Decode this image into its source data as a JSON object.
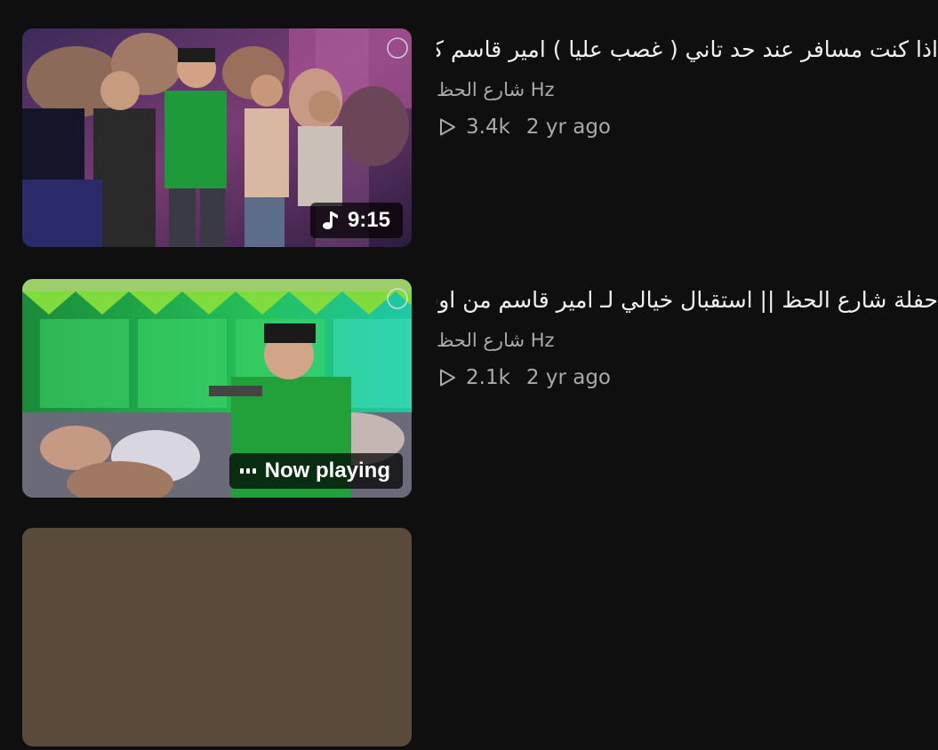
{
  "videos": [
    {
      "title": "اذا كنت مسافر عند حد تاني ( غصب عليا ) امير قاسم كل يوم جديد || لعشاق الروقان",
      "channel": "شارع الحظ Hz",
      "views": "3.4k",
      "age": "2 yr ago",
      "badge": "9:15",
      "badge_icon": "music-note-icon"
    },
    {
      "title": "حفلة شارع الحظ || استقبال خيالي لـ امير قاسم من اوشا والسيد حسن",
      "channel": "شارع الحظ Hz",
      "views": "2.1k",
      "age": "2 yr ago",
      "badge": "Now playing",
      "badge_icon": "equalizer-icon"
    }
  ],
  "colors": {
    "background": "#0f0f0f",
    "title_text": "#f1f1f1",
    "secondary_text": "#aaaaaa",
    "badge_bg": "#000000b8"
  }
}
